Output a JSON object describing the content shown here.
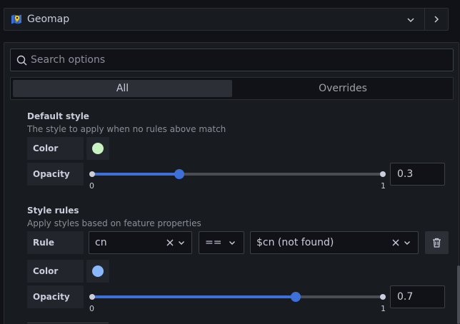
{
  "header": {
    "viz_name": "Geomap",
    "icon": "geomap-icon"
  },
  "search": {
    "placeholder": "Search options",
    "value": ""
  },
  "tabs": [
    {
      "label": "All",
      "active": true
    },
    {
      "label": "Overrides",
      "active": false
    }
  ],
  "default_style": {
    "title": "Default style",
    "description": "The style to apply when no rules above match",
    "color_label": "Color",
    "color_value": "#c8f2c2",
    "opacity_label": "Opacity",
    "opacity": {
      "min_label": "0",
      "max_label": "1",
      "value": 0.3,
      "display": "0.3"
    }
  },
  "style_rules": {
    "title": "Style rules",
    "description": "Apply styles based on feature properties",
    "rule_label": "Rule",
    "property": "cn",
    "operator": "==",
    "value": "$cn (not found)",
    "color_label": "Color",
    "color_value": "#8ab8ff",
    "opacity_label": "Opacity",
    "opacity": {
      "min_label": "0",
      "max_label": "1",
      "value": 0.7,
      "display": "0.7"
    }
  },
  "colors": {
    "accent": "#3d71d9",
    "background": "#111217",
    "panel": "#181b1f"
  }
}
